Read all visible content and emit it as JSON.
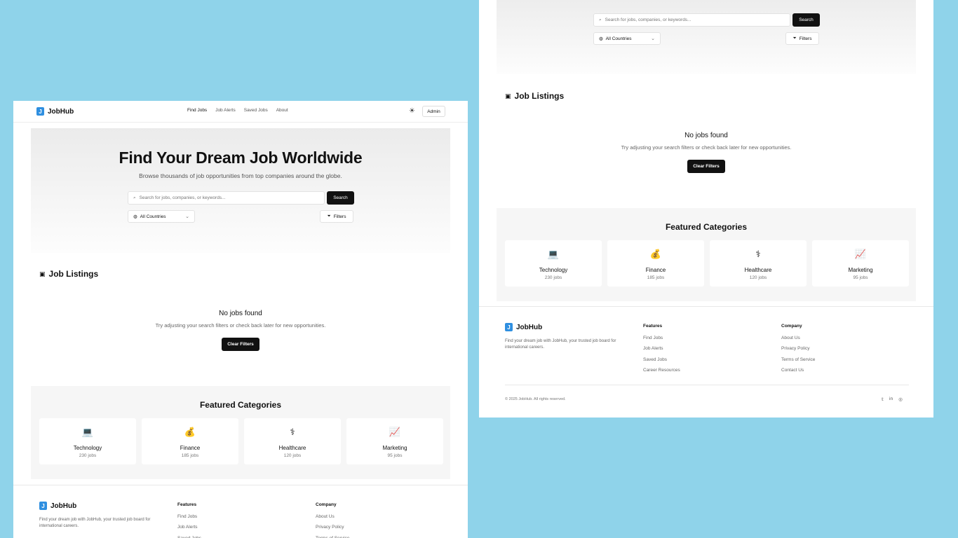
{
  "app": {
    "name": "JobHub",
    "logo_glyph": "J",
    "brand_color": "#2f8fe0"
  },
  "nav": {
    "links": [
      "Find Jobs",
      "Job Alerts",
      "Saved Jobs",
      "About"
    ],
    "admin_label": "Admin",
    "theme_icon": "sun-icon"
  },
  "hero": {
    "title": "Find Your Dream Job Worldwide",
    "subtitle": "Browse thousands of job opportunities from top companies around the globe.",
    "search_placeholder": "Search for jobs, companies, or keywords...",
    "search_button": "Search",
    "country_select": "All Countries",
    "filters_button": "Filters"
  },
  "listings": {
    "title": "Job Listings",
    "empty_title": "No jobs found",
    "empty_message": "Try adjusting your search filters or check back later for new opportunities.",
    "clear_button": "Clear Filters"
  },
  "featured": {
    "title": "Featured Categories",
    "categories": [
      {
        "name": "Technology",
        "count": "230 jobs",
        "icon": "laptop-icon"
      },
      {
        "name": "Finance",
        "count": "185 jobs",
        "icon": "money-bag-icon"
      },
      {
        "name": "Healthcare",
        "count": "120 jobs",
        "icon": "caduceus-icon"
      },
      {
        "name": "Marketing",
        "count": "95 jobs",
        "icon": "chart-icon"
      }
    ]
  },
  "footer": {
    "brand": "JobHub",
    "description": "Find your dream job with JobHub, your trusted job board for international careers.",
    "features_title": "Features",
    "features": [
      "Find Jobs",
      "Job Alerts",
      "Saved Jobs",
      "Career Resources"
    ],
    "company_title": "Company",
    "company": [
      "About Us",
      "Privacy Policy",
      "Terms of Service",
      "Contact Us"
    ],
    "copyright": "© 2025 JobHub. All rights reserved.",
    "social_icons": [
      "twitter-icon",
      "linkedin-icon",
      "github-icon"
    ]
  }
}
